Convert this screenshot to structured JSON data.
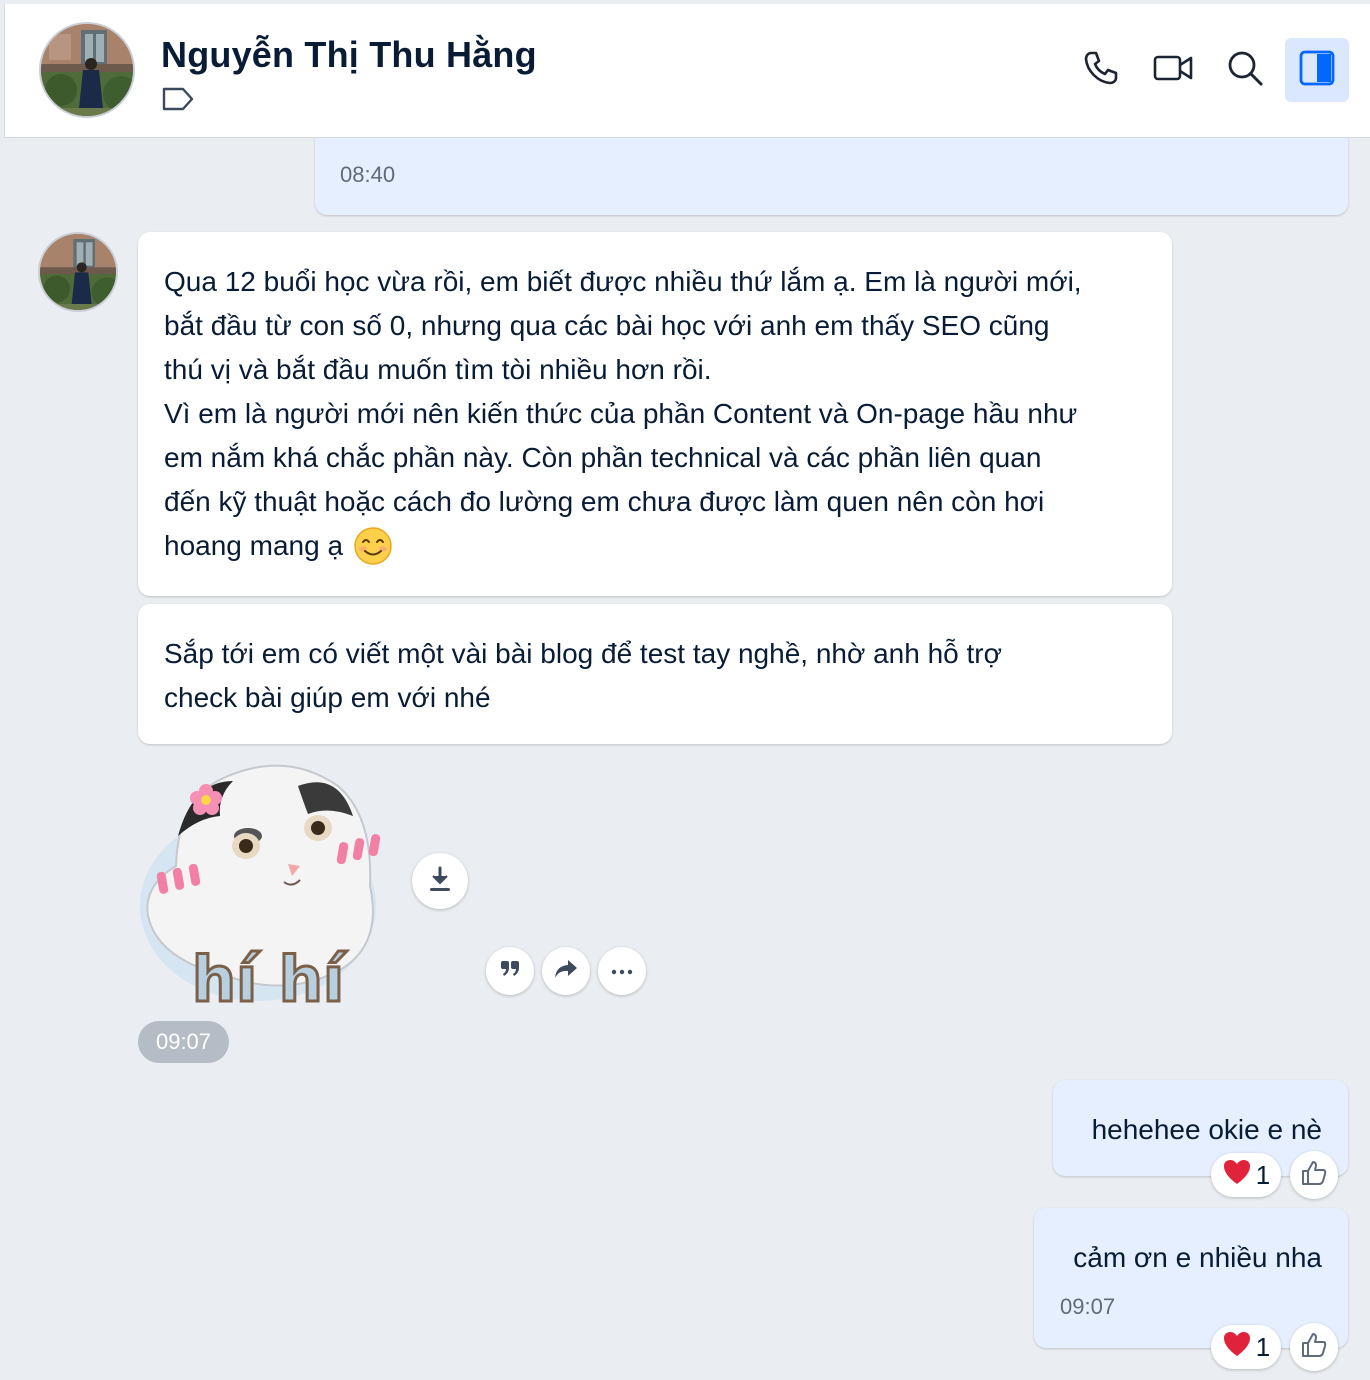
{
  "header": {
    "contact_name": "Nguyễn Thị Thu Hằng",
    "icons": [
      "phone-icon",
      "video-call-icon",
      "search-icon",
      "sidebar-toggle-icon"
    ]
  },
  "messages": {
    "top_outgoing": {
      "time": "08:40"
    },
    "incoming_1": {
      "lines": [
        "Qua 12 buổi học vừa rồi, em biết được nhiều thứ lắm ạ. Em là người mới,",
        "bắt đầu từ con số 0, nhưng qua các bài học với anh em thấy SEO cũng",
        "thú vị và bắt đầu muốn tìm tòi nhiều hơn rồi.",
        "Vì em là người mới nên kiến thức của phần Content và On-page hầu như",
        "em nắm khá chắc phần này. Còn phần technical và các phần liên quan",
        "đến kỹ thuật hoặc cách đo lường em chưa được làm quen nên còn hơi",
        "hoang mang ạ"
      ],
      "emoji": "😊"
    },
    "incoming_2": {
      "lines": [
        "Sắp tới em có viết một vài bài blog để test tay nghề, nhờ anh hỗ trợ",
        "check bài giúp em với nhé"
      ]
    },
    "sticker": {
      "caption": "hí hí",
      "time": "09:07"
    },
    "outgoing_1": {
      "text": "hehehee okie e nè",
      "reaction_count": "1"
    },
    "outgoing_2": {
      "text": "cảm ơn e nhiều nha",
      "time": "09:07",
      "reaction_count": "1"
    }
  },
  "colors": {
    "outgoing_bubble": "#e5efff",
    "incoming_bubble": "#ffffff",
    "background": "#eaedf1",
    "accent": "#0068ff"
  }
}
